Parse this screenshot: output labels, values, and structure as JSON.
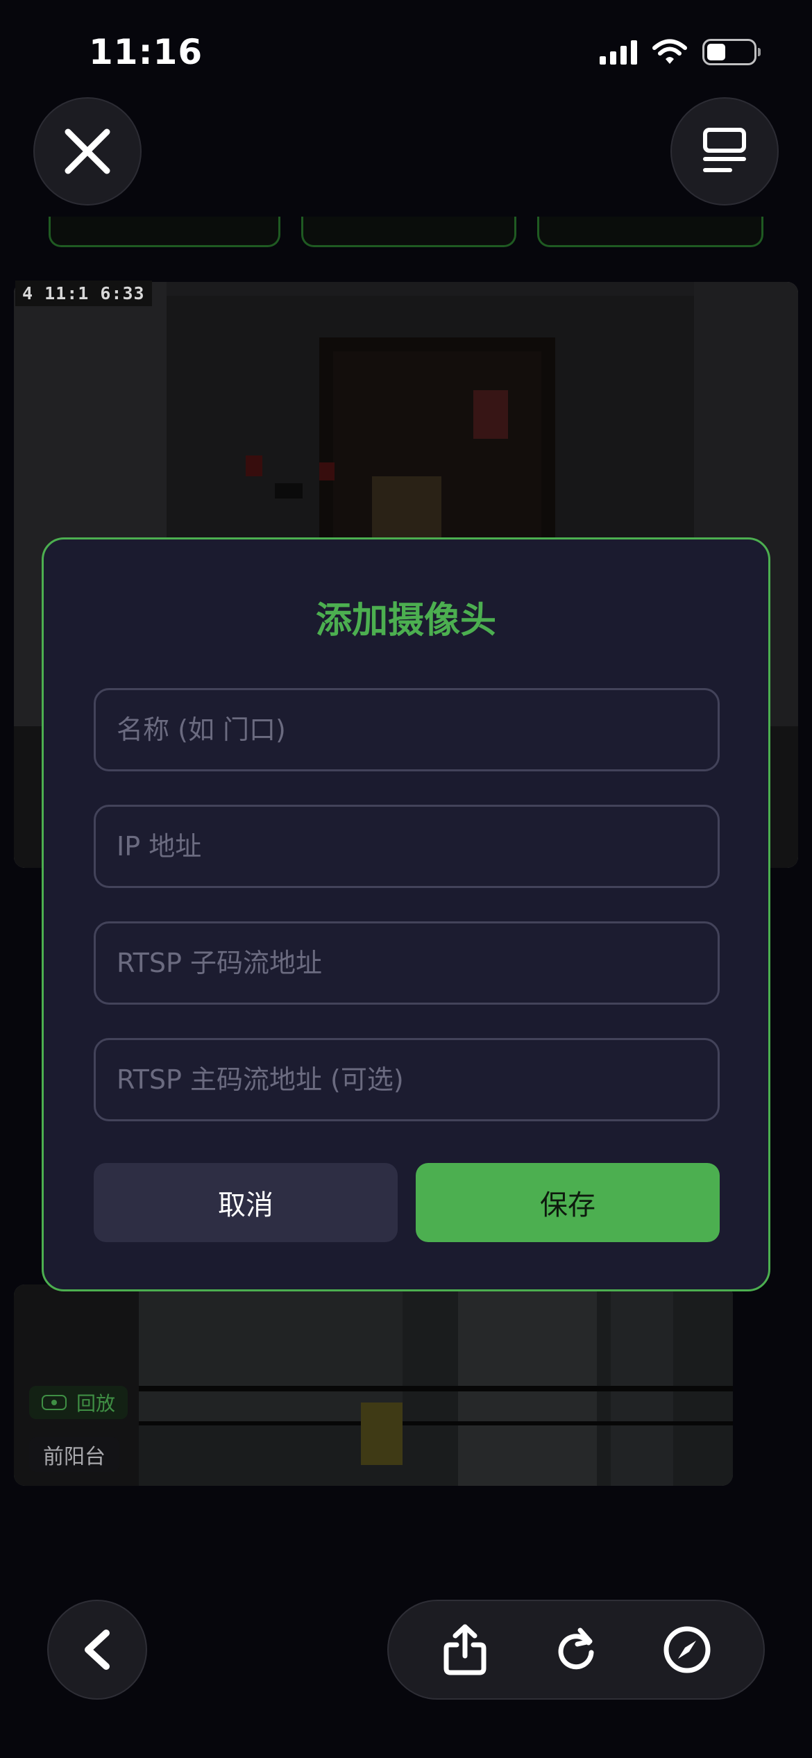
{
  "status_bar": {
    "time": "11:16"
  },
  "top_bar": {
    "close_icon": "close-icon",
    "menu_icon": "list-icon"
  },
  "camera_feed_top": {
    "osd_timestamp": "4  11:1 6:33"
  },
  "camera_feed_bottom": {
    "replay_label": "回放",
    "camera_name": "前阳台"
  },
  "modal": {
    "title": "添加摄像头",
    "fields": {
      "name_placeholder": "名称 (如 门口)",
      "ip_placeholder": "IP 地址",
      "rtsp_sub_placeholder": "RTSP 子码流地址",
      "rtsp_main_placeholder": "RTSP 主码流地址 (可选)"
    },
    "cancel_label": "取消",
    "save_label": "保存"
  },
  "bottom_toolbar": {
    "back_icon": "chevron-left-icon",
    "share_icon": "share-icon",
    "reload_icon": "reload-icon",
    "compass_icon": "compass-icon"
  },
  "colors": {
    "accent": "#4caf50",
    "modal_bg": "#1b1b2f",
    "field_border": "#43435a",
    "cancel_bg": "#2e2e44"
  }
}
